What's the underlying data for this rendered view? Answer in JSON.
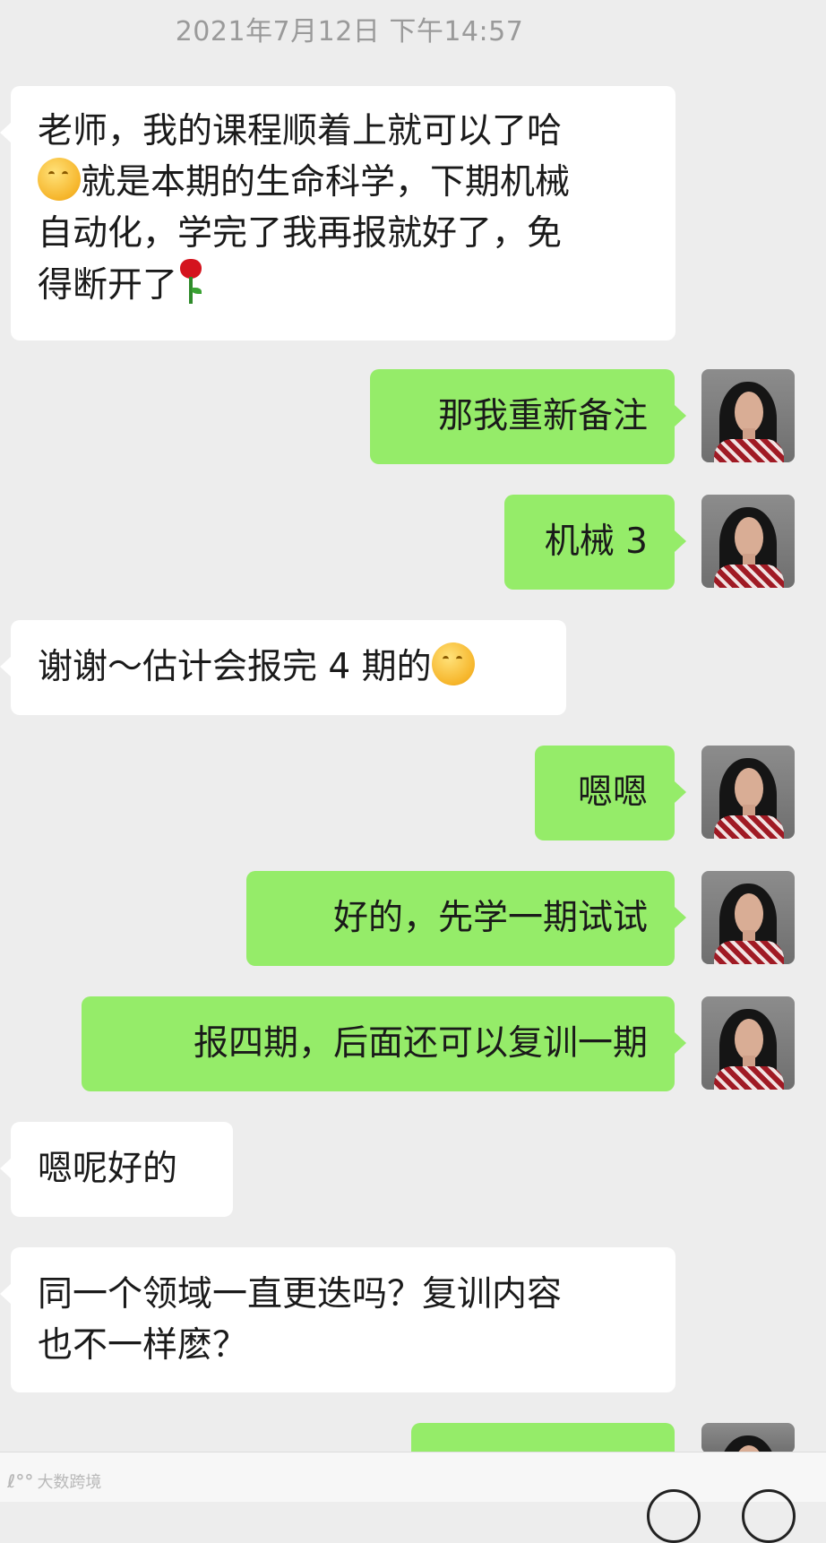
{
  "timestamp": "2021年7月12日 下午14:57",
  "messages": [
    {
      "from": "contact",
      "lines": [
        "老师，我的课程顺着上就可以了哈",
        "就是本期的生命科学，下期机械",
        "自动化，学完了我再报就好了，免",
        "得断开了"
      ]
    },
    {
      "from": "me",
      "text": "那我重新备注"
    },
    {
      "from": "me",
      "text": "机械 3"
    },
    {
      "from": "contact",
      "text": "谢谢～估计会报完 4 期的"
    },
    {
      "from": "me",
      "text": "嗯嗯"
    },
    {
      "from": "me",
      "text": "好的，先学一期试试"
    },
    {
      "from": "me",
      "text": "报四期，后面还可以复训一期"
    },
    {
      "from": "contact",
      "text": "嗯呢好的"
    },
    {
      "from": "contact",
      "lines": [
        "同一个领域一直更迭吗？复训内容",
        "也不一样麽？"
      ]
    }
  ],
  "watermark": {
    "logo": "ℓ°°",
    "text": "大数跨境"
  },
  "colors": {
    "background": "#ededed",
    "incoming": "#ffffff",
    "outgoing": "#95ec69"
  }
}
